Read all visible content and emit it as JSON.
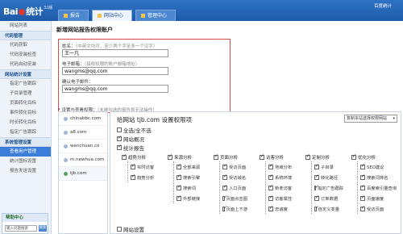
{
  "header": {
    "logo_text": "Bai",
    "logo_suffix": "统计",
    "logo_version": "3.0版",
    "toplink": "百度统计",
    "tabs": [
      {
        "label": "报告",
        "active": false
      },
      {
        "label": "网站中心",
        "active": true
      },
      {
        "label": "管理中心",
        "active": false
      }
    ]
  },
  "sidebar": {
    "items": [
      {
        "type": "item",
        "label": "网站列表"
      },
      {
        "type": "head",
        "label": "代码管理"
      },
      {
        "type": "item",
        "label": "代码获取"
      },
      {
        "type": "item",
        "label": "代码安装检查"
      },
      {
        "type": "item",
        "label": "代码自动安装"
      },
      {
        "type": "head",
        "label": "网站统计设置"
      },
      {
        "type": "item",
        "label": "指定广告跟踪"
      },
      {
        "type": "item",
        "label": "子目录管理"
      },
      {
        "type": "item",
        "label": "页面转化目标"
      },
      {
        "type": "item",
        "label": "事件转化目标"
      },
      {
        "type": "item",
        "label": "时长转化目标"
      },
      {
        "type": "item",
        "label": "指定广告跟踪"
      },
      {
        "type": "head",
        "label": "系统管理设置"
      },
      {
        "type": "item",
        "label": "查看用户管理",
        "active": true
      },
      {
        "type": "item",
        "label": "统计图标设置"
      },
      {
        "type": "item",
        "label": "报告发送设置"
      }
    ],
    "help": {
      "title": "帮助中心",
      "input_value": "输入问题搜索",
      "button": "搜索"
    }
  },
  "main": {
    "page_title": "新增网站报告权限账户",
    "form": {
      "name_label": "姓名：",
      "name_hint": "（中英文均可，至少两个字至多一个汉字）",
      "name_value": "王一凡",
      "email_label": "电子邮箱：",
      "email_hint": "（接收权限的账户邮箱地址）",
      "email_value": "wangms@qq.com",
      "confirm_label": "确认电子邮件：",
      "confirm_value": "wangms@qq.com"
    },
    "perm_note": "* 设置与查看权限：",
    "perm_hint": "（未被勾选的报告将无法操作）",
    "sites": [
      {
        "label": "chinabbc.com",
        "active": false
      },
      {
        "label": "a8.com",
        "active": false
      },
      {
        "label": "wenchuan.co",
        "active": false
      },
      {
        "label": "m.newhua.com",
        "active": false
      },
      {
        "label": "tjb.com",
        "active": true
      }
    ],
    "panel": {
      "title": "给网站 tjb.com 设置权限项",
      "select_value": "复制本站选择权限网站",
      "select_all": "全选/全不选",
      "site_overview": "网站概况",
      "stat_report": "统计报告",
      "site_settings": "网站设置",
      "groups": [
        {
          "head": "趋势分析",
          "items": [
            "实时访客",
            "趋势分析"
          ]
        },
        {
          "head": "来源分析",
          "items": [
            "全部来源",
            "搜索引擎",
            "搜索词",
            "外部链接"
          ]
        },
        {
          "head": "页面分析",
          "items": [
            "受访页面",
            "受访域名",
            "入口页面",
            "页面点击图",
            "页面上下游"
          ]
        },
        {
          "head": "访客分析",
          "items": [
            "地域分布",
            "系统环境",
            "新老访客",
            "访客属性",
            "忠诚度"
          ]
        },
        {
          "head": "定制分析",
          "items": [
            "子目录",
            "转化路径",
            "指定广告跟踪",
            "订单数据",
            "自定义变量"
          ]
        },
        {
          "head": "优化分析",
          "items": [
            "SEO建议",
            "搜索词排名",
            "百度索引量查询",
            "页面速度",
            "受访页面"
          ]
        }
      ]
    }
  }
}
